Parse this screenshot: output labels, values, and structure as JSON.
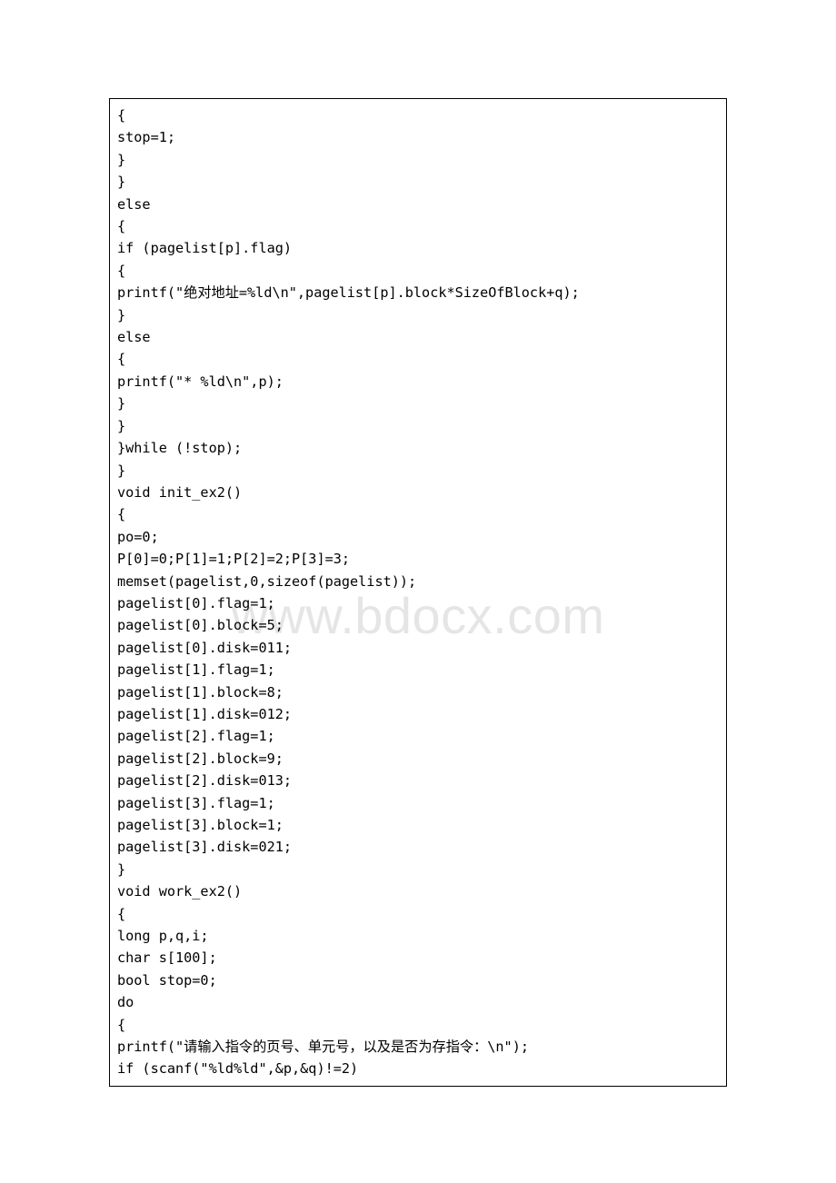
{
  "watermark": "www.bdocx.com",
  "code": {
    "lines": [
      "{",
      "stop=1;",
      "}",
      "}",
      "else",
      "{",
      "if (pagelist[p].flag)",
      "{",
      "printf(\"绝对地址=%ld\\n\",pagelist[p].block*SizeOfBlock+q);",
      "}",
      "else",
      "{",
      "printf(\"* %ld\\n\",p);",
      "}",
      "}",
      "}while (!stop);",
      "}",
      "void init_ex2()",
      "{",
      "po=0;",
      "P[0]=0;P[1]=1;P[2]=2;P[3]=3;",
      "memset(pagelist,0,sizeof(pagelist));",
      "pagelist[0].flag=1;",
      "pagelist[0].block=5;",
      "pagelist[0].disk=011;",
      "pagelist[1].flag=1;",
      "pagelist[1].block=8;",
      "pagelist[1].disk=012;",
      "pagelist[2].flag=1;",
      "pagelist[2].block=9;",
      "pagelist[2].disk=013;",
      "pagelist[3].flag=1;",
      "pagelist[3].block=1;",
      "pagelist[3].disk=021;",
      "}",
      "void work_ex2()",
      "{",
      "long p,q,i;",
      "char s[100];",
      "bool stop=0;",
      "do",
      "{",
      "printf(\"请输入指令的页号、单元号，以及是否为存指令：\\n\");",
      "if (scanf(\"%ld%ld\",&p,&q)!=2)"
    ]
  }
}
